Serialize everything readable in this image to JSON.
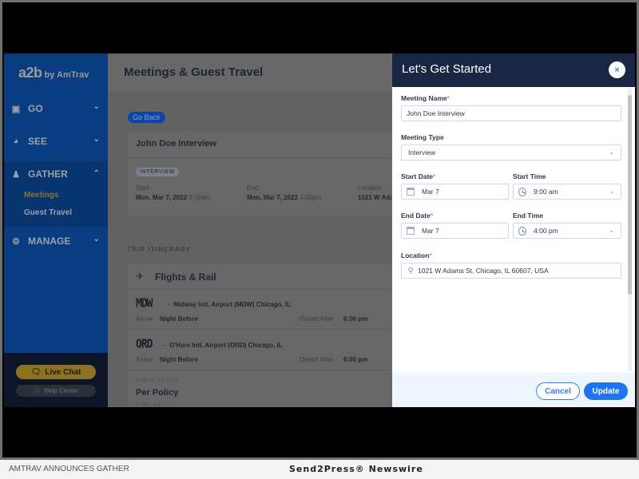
{
  "sidebar": {
    "logo_main": "a2b",
    "logo_sub": "by AmTrav",
    "items": [
      {
        "label": "GO",
        "icon": "suitcase-icon",
        "chevron": "chevron-down"
      },
      {
        "label": "SEE",
        "icon": "gauge-icon",
        "chevron": "chevron-down"
      },
      {
        "label": "GATHER",
        "icon": "users-icon",
        "chevron": "chevron-up",
        "expanded": true
      },
      {
        "label": "MANAGE",
        "icon": "gear-icon",
        "chevron": "chevron-down"
      }
    ],
    "gather_subitems": [
      "Meetings",
      "Guest Travel"
    ],
    "live_chat": "Live Chat",
    "help_center": "Help Center"
  },
  "main": {
    "page_title": "Meetings & Guest Travel",
    "go_back": "Go Back",
    "meeting": {
      "title": "John Doe Interview",
      "tag": "INTERVIEW",
      "start_label": "Start",
      "start_date": "Mon, Mar 7, 2022",
      "start_time": "9:00am",
      "end_label": "End",
      "end_date": "Mon, Mar 7, 2022",
      "end_time": "4:00pm",
      "location_label": "Location",
      "location_value": "1021 W Ada"
    },
    "itinerary_label": "TRIP ITINERARY",
    "flights": {
      "title": "Flights & Rail",
      "airports": [
        {
          "code": "MDW",
          "name": "Midway Intl. Airport (MDW) Chicago, IL",
          "arrive_label": "Arrive",
          "arrive_value": "Night Before",
          "depart_label": "Depart After",
          "depart_value": "6:00 pm"
        },
        {
          "code": "ORD",
          "name": "O'Hare Intl. Airport (ORD) Chicago, IL",
          "arrive_label": "Arrive",
          "arrive_value": "Night Before",
          "depart_label": "Depart After",
          "depart_value": "6:00 pm"
        }
      ],
      "cabin_class_label": "CABIN CLASS:",
      "cabin_class_value": "Per Policy",
      "airline_label": "AIRLINE:"
    }
  },
  "panel": {
    "title": "Let's Get Started",
    "close_icon": "×",
    "meeting_name_label": "Meeting Name",
    "meeting_name_value": "John Doe Interview",
    "meeting_type_label": "Meeting Type",
    "meeting_type_value": "Interview",
    "start_date_label": "Start Date",
    "start_date_value": "Mar 7",
    "start_time_label": "Start Time",
    "start_time_value": "9:00 am",
    "end_date_label": "End Date",
    "end_date_value": "Mar 7",
    "end_time_label": "End Time",
    "end_time_value": "4:00 pm",
    "location_label": "Location",
    "location_value": "1021 W Adams St, Chicago, IL 60607, USA",
    "required_mark": "*",
    "cancel": "Cancel",
    "update": "Update"
  },
  "caption": {
    "left": "AMTRAV ANNOUNCES GATHER",
    "right": "Send2Press® Newswire"
  },
  "colors": {
    "sidebar": "#0a3c82",
    "panel_header": "#1a2744",
    "accent_blue": "#1f74ef",
    "required_orange": "#e8922b",
    "live_chat": "#8e7223"
  }
}
